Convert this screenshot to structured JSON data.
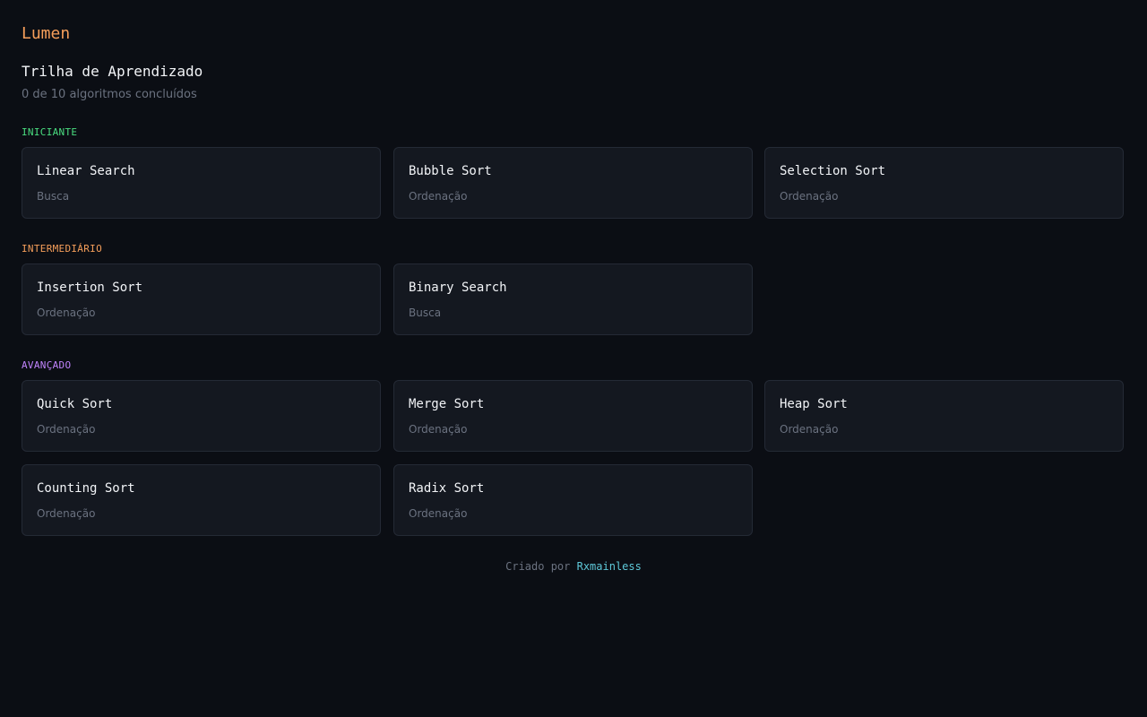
{
  "brand": "Lumen",
  "page": {
    "title": "Trilha de Aprendizado",
    "progress": "0 de 10 algoritmos concluídos"
  },
  "colors": {
    "beginner": "#4ade80",
    "intermediate": "#f59e5a",
    "advanced": "#c084fc",
    "link": "#5ec8d8"
  },
  "sections": {
    "beginner": {
      "label": "INICIANTE",
      "cards": [
        {
          "title": "Linear Search",
          "category": "Busca"
        },
        {
          "title": "Bubble Sort",
          "category": "Ordenação"
        },
        {
          "title": "Selection Sort",
          "category": "Ordenação"
        }
      ]
    },
    "intermediate": {
      "label": "INTERMEDIÁRIO",
      "cards": [
        {
          "title": "Insertion Sort",
          "category": "Ordenação"
        },
        {
          "title": "Binary Search",
          "category": "Busca"
        }
      ]
    },
    "advanced": {
      "label": "AVANÇADO",
      "cards": [
        {
          "title": "Quick Sort",
          "category": "Ordenação"
        },
        {
          "title": "Merge Sort",
          "category": "Ordenação"
        },
        {
          "title": "Heap Sort",
          "category": "Ordenação"
        },
        {
          "title": "Counting Sort",
          "category": "Ordenação"
        },
        {
          "title": "Radix Sort",
          "category": "Ordenação"
        }
      ]
    }
  },
  "footer": {
    "prefix": "Criado por",
    "author": "Rxmainless"
  }
}
